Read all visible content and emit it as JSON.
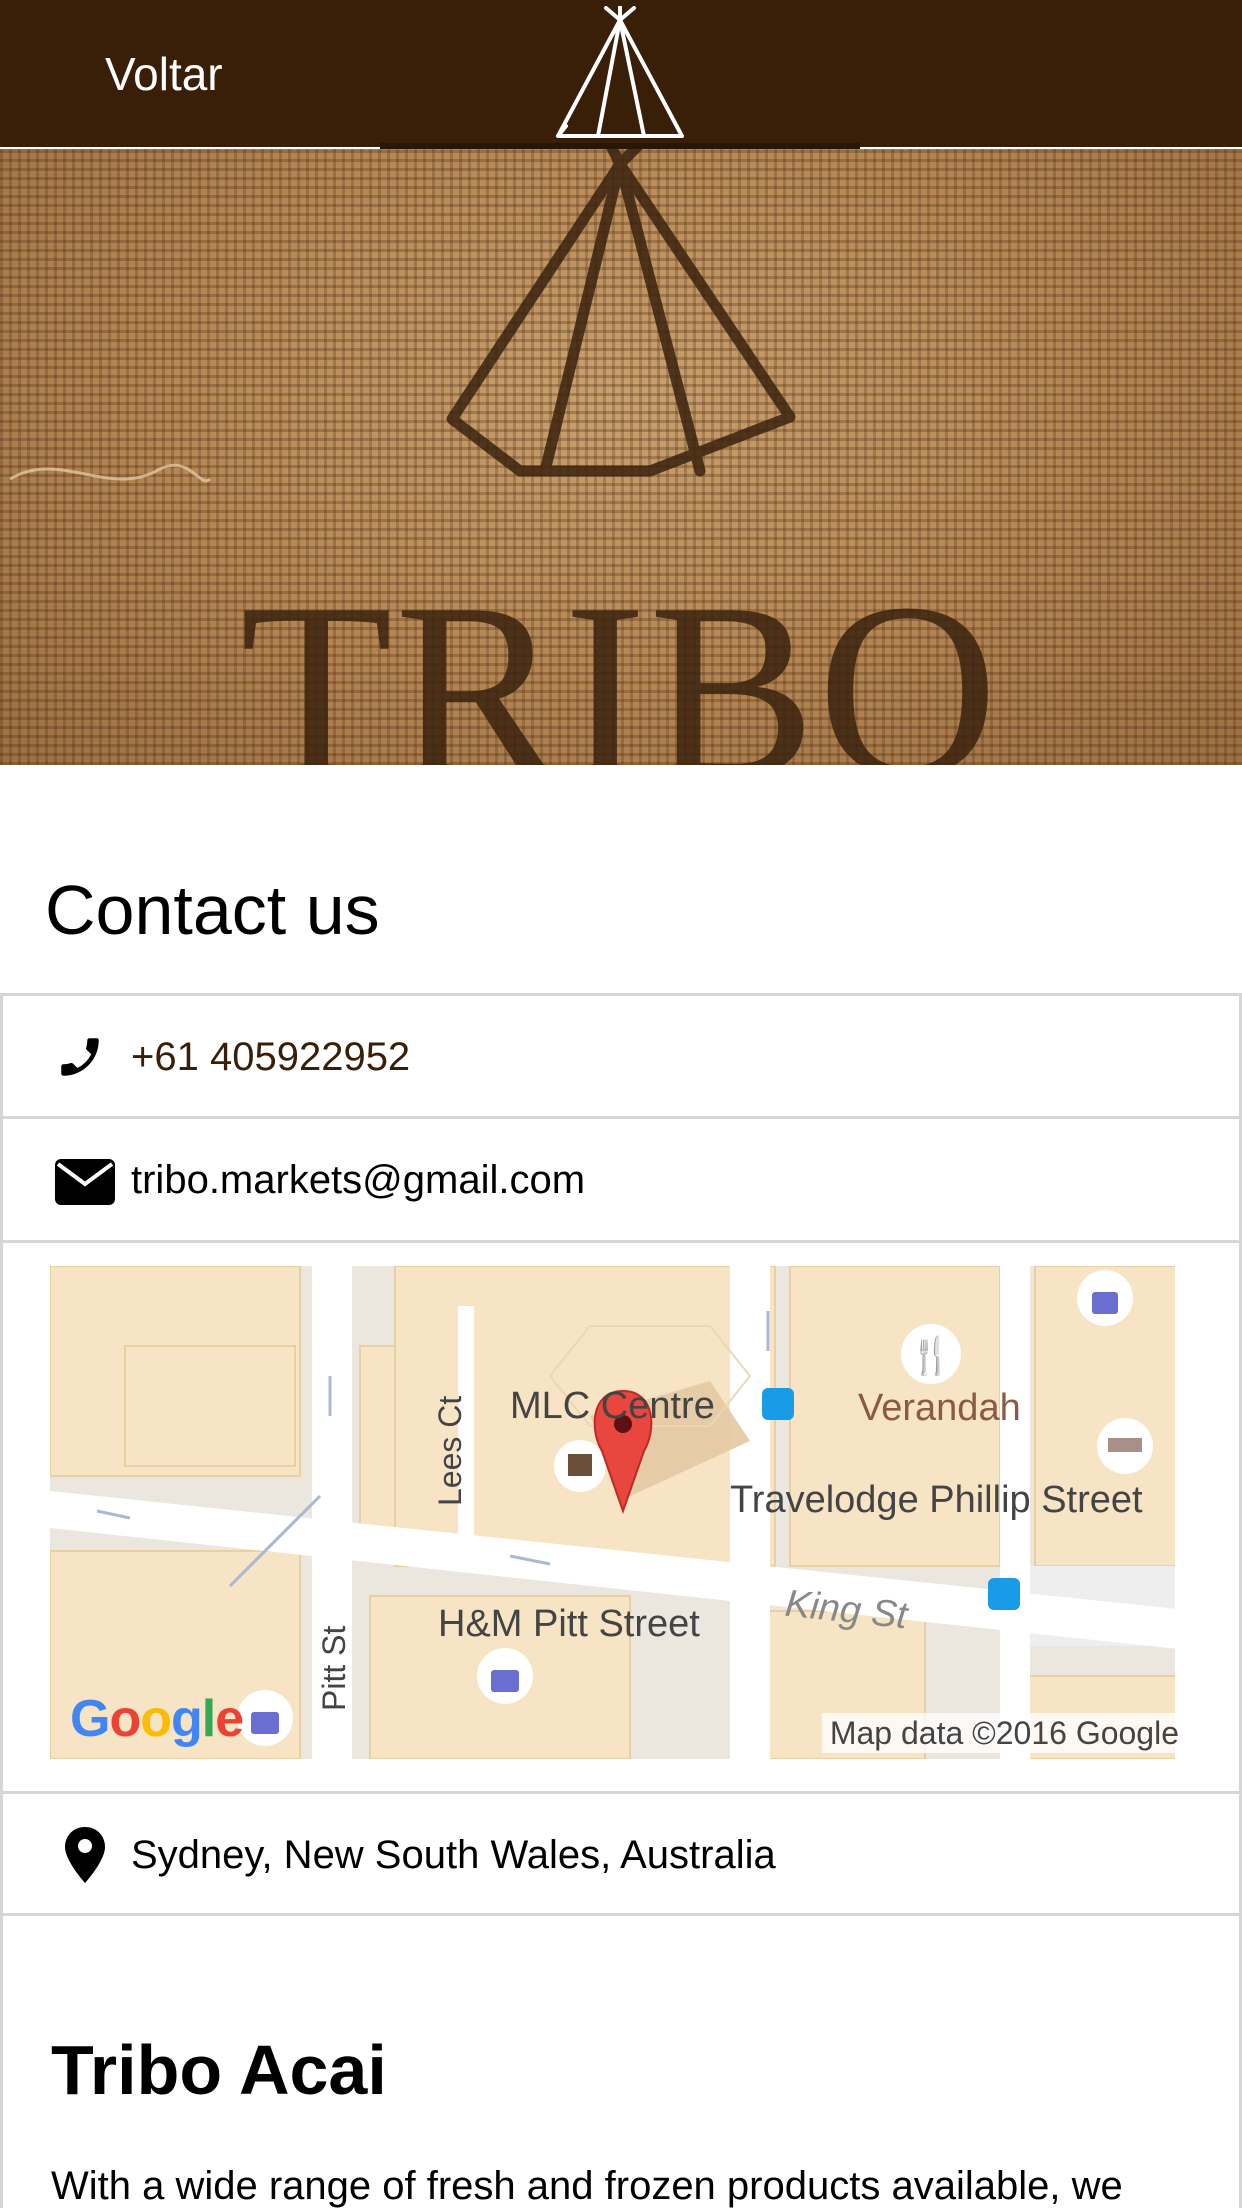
{
  "header": {
    "back_label": "Voltar",
    "logo_icon": "teepee-icon",
    "background_color": "#3a1f08"
  },
  "banner": {
    "brand_text": "TRIBO"
  },
  "contact": {
    "title": "Contact us",
    "phone": {
      "icon": "phone-icon",
      "value": "+61 405922952",
      "color": "#3a1f08"
    },
    "email": {
      "icon": "envelope-icon",
      "value": "tribo.markets@gmail.com"
    },
    "map": {
      "labels": {
        "mlc": "MLC Centre",
        "verandah": "Verandah",
        "travelodge": "Travelodge Phillip Street",
        "hm": "H&M Pitt Street",
        "king": "King St",
        "lees": "Lees Ct",
        "pitt": "Pitt St"
      },
      "attribution": "Map data ©2016 Google",
      "logo": "Google",
      "marker_color": "#e8463e"
    },
    "address": {
      "icon": "map-pin-icon",
      "value": "Sydney, New South Wales, Australia"
    }
  },
  "about": {
    "title": "Tribo Acai",
    "text": "With a wide range of fresh and frozen products available, we"
  }
}
